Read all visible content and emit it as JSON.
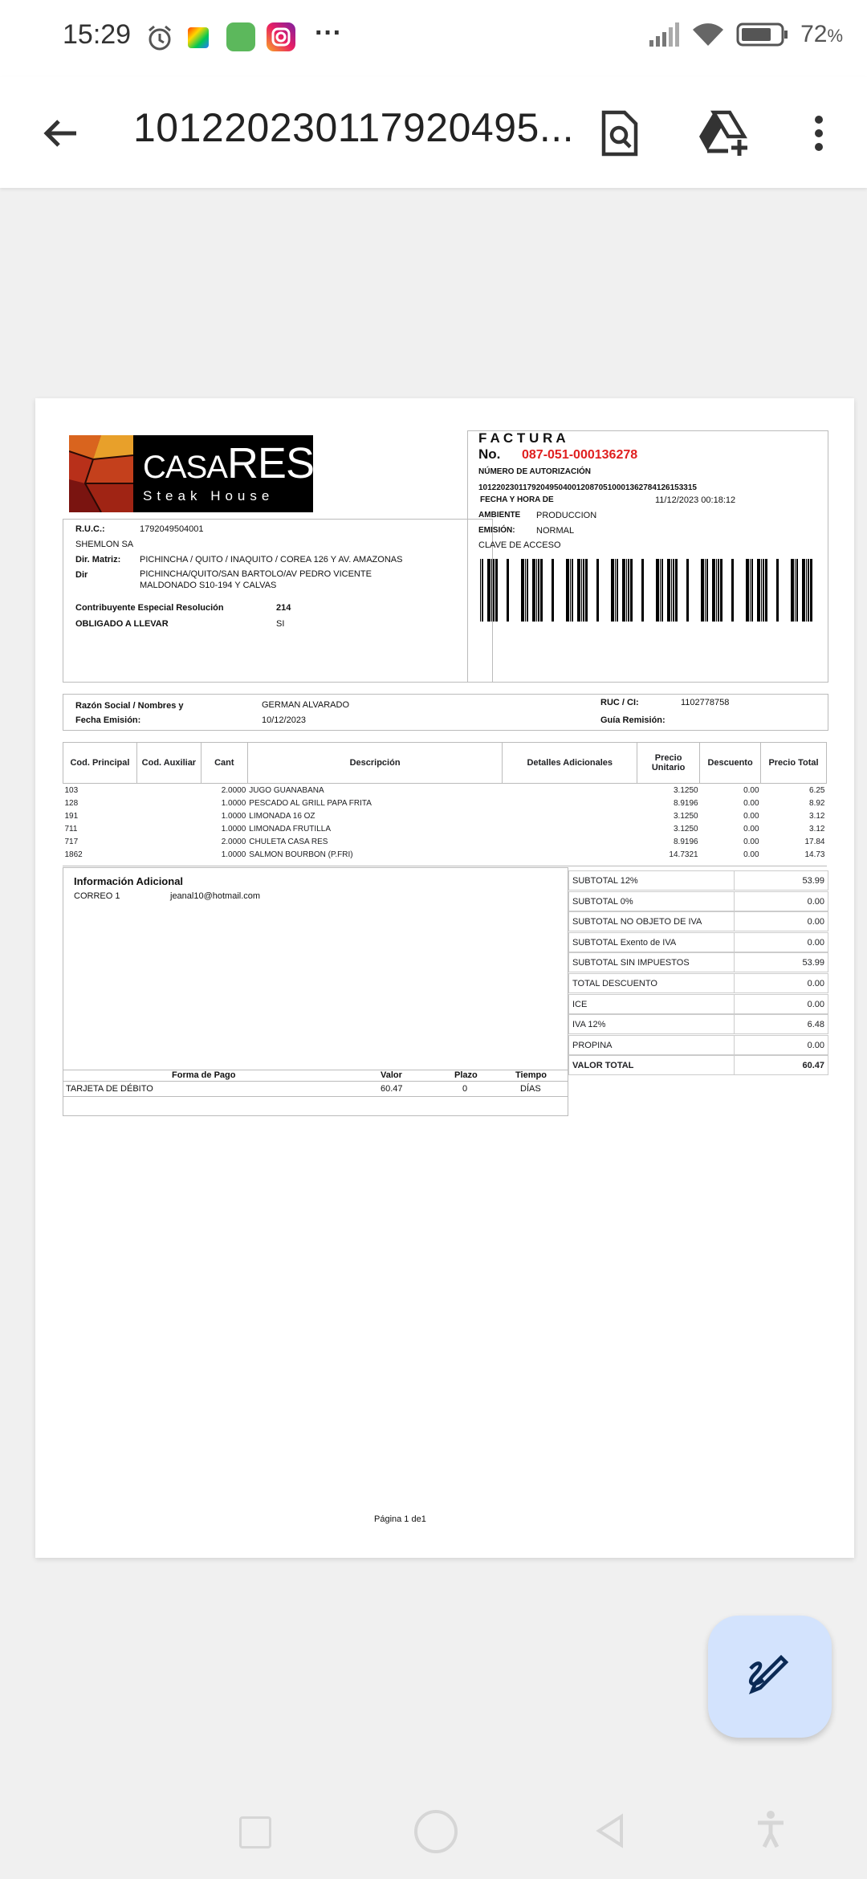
{
  "status_bar": {
    "time": "15:29",
    "battery": "72",
    "battery_unit": "%",
    "dots": "···"
  },
  "app_bar": {
    "title": "101220230117920495..."
  },
  "invoice": {
    "header": {
      "title": "F A C T U R A",
      "no_label": "No.",
      "number": "087-051-000136278",
      "auth_label": "NÚMERO DE AUTORIZACIÓN",
      "auth_number": "1012202301179204950400120870510001362784126153315",
      "fecha_label": "FECHA Y HORA DE",
      "fecha_value": "11/12/2023 00:18:12",
      "ambiente_label": "AMBIENTE",
      "ambiente_value": "PRODUCCION",
      "emision_label": "EMISIÓN:",
      "emision_value": "NORMAL",
      "clave_label": "CLAVE DE ACCESO"
    },
    "logo": {
      "brand_a": "CASA",
      "brand_b": "RES",
      "subtitle": "Steak House"
    },
    "issuer": {
      "ruc_label": "R.U.C.:",
      "ruc_value": "1792049504001",
      "name": "SHEMLON SA",
      "matriz_label": "Dir. Matriz:",
      "matriz_value": "PICHINCHA / QUITO / INAQUITO / COREA 126 Y AV. AMAZONAS",
      "dir_label": "Dir",
      "dir_value_1": "PICHINCHA/QUITO/SAN BARTOLO/AV PEDRO VICENTE",
      "dir_value_2": "MALDONADO S10-194 Y CALVAS",
      "contrib_label": "Contribuyente Especial Resolución",
      "contrib_value": "214",
      "oblig_label": "OBLIGADO A LLEVAR",
      "oblig_value": "SI"
    },
    "customer": {
      "razon_label": "Razón Social / Nombres y",
      "razon_value": "GERMAN ALVARADO",
      "fecha_label": "Fecha Emisión:",
      "fecha_value": "10/12/2023",
      "ruc_label": "RUC / CI:",
      "ruc_value": "1102778758",
      "guia_label": "Guía Remisión:"
    },
    "columns": [
      "Cod. Principal",
      "Cod. Auxiliar",
      "Cant",
      "Descripción",
      "Detalles Adicionales",
      "Precio Unitario",
      "Descuento",
      "Precio Total"
    ],
    "items": [
      {
        "cod": "103",
        "cant": "2.0000",
        "desc": "JUGO GUANABANA",
        "pu": "3.1250",
        "dscto": "0.00",
        "total": "6.25"
      },
      {
        "cod": "128",
        "cant": "1.0000",
        "desc": "PESCADO AL GRILL PAPA FRITA",
        "pu": "8.9196",
        "dscto": "0.00",
        "total": "8.92"
      },
      {
        "cod": "191",
        "cant": "1.0000",
        "desc": "LIMONADA 16 OZ",
        "pu": "3.1250",
        "dscto": "0.00",
        "total": "3.12"
      },
      {
        "cod": "711",
        "cant": "1.0000",
        "desc": "LIMONADA FRUTILLA",
        "pu": "3.1250",
        "dscto": "0.00",
        "total": "3.12"
      },
      {
        "cod": "717",
        "cant": "2.0000",
        "desc": "CHULETA CASA RES",
        "pu": "8.9196",
        "dscto": "0.00",
        "total": "17.84"
      },
      {
        "cod": "1862",
        "cant": "1.0000",
        "desc": "SALMON BOURBON (P.FRI)",
        "pu": "14.7321",
        "dscto": "0.00",
        "total": "14.73"
      }
    ],
    "info": {
      "title": "Información Adicional",
      "label": "CORREO 1",
      "value": "jeanal10@hotmail.com"
    },
    "totals": [
      {
        "label": "SUBTOTAL 12%",
        "value": "53.99"
      },
      {
        "label": "SUBTOTAL 0%",
        "value": "0.00"
      },
      {
        "label": "SUBTOTAL NO OBJETO DE IVA",
        "value": "0.00"
      },
      {
        "label": "SUBTOTAL Exento de IVA",
        "value": "0.00"
      },
      {
        "label": "SUBTOTAL SIN IMPUESTOS",
        "value": "53.99"
      },
      {
        "label": "TOTAL DESCUENTO",
        "value": "0.00"
      },
      {
        "label": "ICE",
        "value": "0.00"
      },
      {
        "label": "IVA 12%",
        "value": "6.48"
      },
      {
        "label": "PROPINA",
        "value": "0.00"
      },
      {
        "label": "VALOR TOTAL",
        "value": "60.47"
      }
    ],
    "payment": {
      "headers": [
        "Forma de Pago",
        "Valor",
        "Plazo",
        "Tiempo"
      ],
      "row": [
        "TARJETA DE DÉBITO",
        "60.47",
        "0",
        "DÍAS"
      ]
    },
    "footer": "Página 1 de1"
  },
  "colors": {
    "accent_red": "#e02020",
    "fab_bg": "#d3e3fd"
  }
}
